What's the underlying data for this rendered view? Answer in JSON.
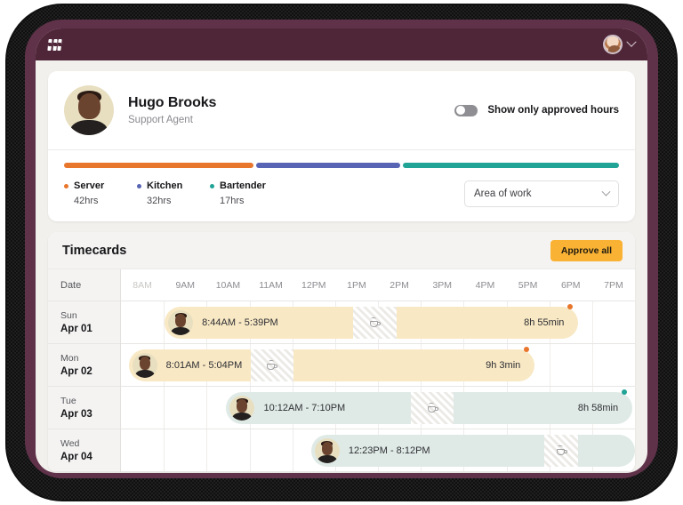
{
  "appbar": {
    "logo_name": "rrr-logo",
    "account_chevron": "chevron-down-icon"
  },
  "profile": {
    "name": "Hugo Brooks",
    "role": "Support Agent",
    "toggle_label": "Show only approved hours",
    "toggle_on": false,
    "select_value": "Area of work"
  },
  "breakdown": {
    "segments": [
      {
        "label": "Server",
        "hours": "42hrs",
        "color": "#e8762c",
        "flex": 42
      },
      {
        "label": "Kitchen",
        "hours": "32hrs",
        "color": "#5864b4",
        "flex": 32
      },
      {
        "label": "Bartender",
        "hours": "17hrs",
        "color": "#21a396",
        "flex": 48
      }
    ]
  },
  "timecards": {
    "title": "Timecards",
    "approve_label": "Approve all",
    "date_header": "Date",
    "hours": [
      "8AM",
      "9AM",
      "10AM",
      "11AM",
      "12PM",
      "1PM",
      "2PM",
      "3PM",
      "4PM",
      "5PM",
      "6PM",
      "7PM"
    ],
    "rows": [
      {
        "dow": "Sun",
        "dom": "Apr 01",
        "range": "8:44AM - 5:39PM",
        "duration": "8h 55min",
        "tone": "amber",
        "dot": "#e8762c",
        "left_pct": 8.5,
        "width_pct": 80.5,
        "break_left_pct": 45.5,
        "break_width_pct": 10.5
      },
      {
        "dow": "Mon",
        "dom": "Apr 02",
        "range": "8:01AM - 5:04PM",
        "duration": "9h 3min",
        "tone": "amber",
        "dot": "#e8762c",
        "left_pct": 1.5,
        "width_pct": 79.0,
        "break_left_pct": 30.0,
        "break_width_pct": 10.5
      },
      {
        "dow": "Tue",
        "dom": "Apr 03",
        "range": "10:12AM - 7:10PM",
        "duration": "8h 58min",
        "tone": "teal",
        "dot": "#21a396",
        "left_pct": 20.5,
        "width_pct": 79.0,
        "break_left_pct": 45.5,
        "break_width_pct": 10.5
      },
      {
        "dow": "Wed",
        "dom": "Apr 04",
        "range": "12:23PM - 8:12PM",
        "duration": "",
        "tone": "teal",
        "dot": "",
        "left_pct": 37.0,
        "width_pct": 63.0,
        "break_left_pct": 72.0,
        "break_width_pct": 10.5
      }
    ]
  }
}
